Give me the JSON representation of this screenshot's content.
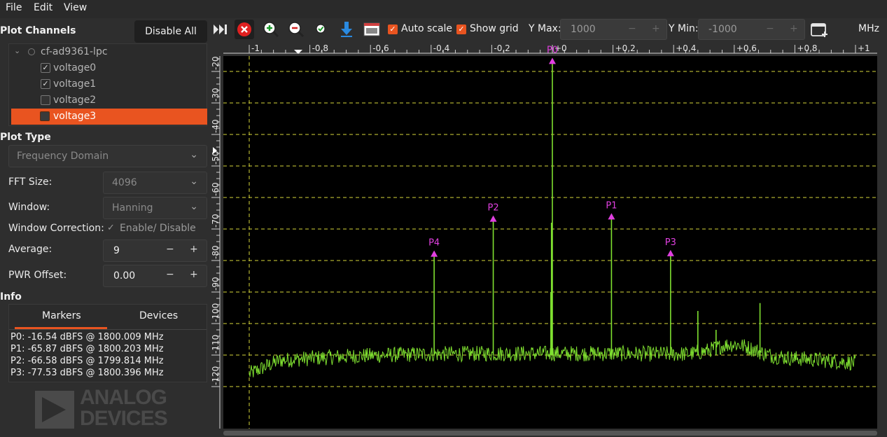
{
  "menubar": {
    "file": "File",
    "edit": "Edit",
    "view": "View"
  },
  "toolbar": {
    "auto_scale": "Auto scale",
    "show_grid": "Show grid",
    "ymax_label": "Y Max:",
    "ymax_value": "1000",
    "ymin_label": "Y Min:",
    "ymin_value": "-1000",
    "minus": "−",
    "plus": "+",
    "unit": "MHz"
  },
  "plot_channels": {
    "title": "Plot Channels",
    "disable_all": "Disable All",
    "device": "cf-ad9361-lpc",
    "channels": [
      {
        "label": "voltage0",
        "checked": true
      },
      {
        "label": "voltage1",
        "checked": true
      },
      {
        "label": "voltage2",
        "checked": false
      },
      {
        "label": "voltage3",
        "checked": false
      }
    ]
  },
  "plot_type": {
    "title": "Plot Type",
    "mode": "Frequency Domain",
    "fft_size_label": "FFT Size:",
    "fft_size": "4096",
    "window_label": "Window:",
    "window": "Hanning",
    "window_correction_label": "Window Correction:",
    "window_correction_value": "Enable/ Disable",
    "average_label": "Average:",
    "average": "9",
    "pwr_offset_label": "PWR Offset:",
    "pwr_offset": "0.00"
  },
  "info": {
    "title": "Info",
    "tab_markers": "Markers",
    "tab_devices": "Devices",
    "markers": [
      "P0: -16.54 dBFS @ 1800.009 MHz",
      "P1: -65.87 dBFS @ 1800.203 MHz",
      "P2: -66.58 dBFS @ 1799.814 MHz",
      "P3: -77.53 dBFS @ 1800.396 MHz"
    ]
  },
  "logo": {
    "line1": "ANALOG",
    "line2": "DEVICES"
  },
  "colors": {
    "accent": "#e95420",
    "trace": "#7fe030",
    "marker": "#e040e0",
    "grid": "#d6d63a"
  },
  "plot": {
    "x_ticks": [
      "-1",
      "-0,8",
      "-0,6",
      "-0,4",
      "-0,2",
      "+0",
      "+0,2",
      "+0,4",
      "+0,6",
      "+0,8",
      "+1"
    ],
    "y_ticks": [
      "-10",
      "-20",
      "-30",
      "-40",
      "-50",
      "-60",
      "-70",
      "-80",
      "-90",
      "-100",
      "-110",
      "-120"
    ],
    "peaks": [
      {
        "label": "P0",
        "x": 0.0,
        "y": -16.54
      },
      {
        "label": "P1",
        "x": 0.195,
        "y": -65.87
      },
      {
        "label": "P2",
        "x": -0.195,
        "y": -66.58
      },
      {
        "label": "P3",
        "x": 0.39,
        "y": -77.53
      },
      {
        "label": "P4",
        "x": -0.39,
        "y": -77.7
      }
    ]
  }
}
